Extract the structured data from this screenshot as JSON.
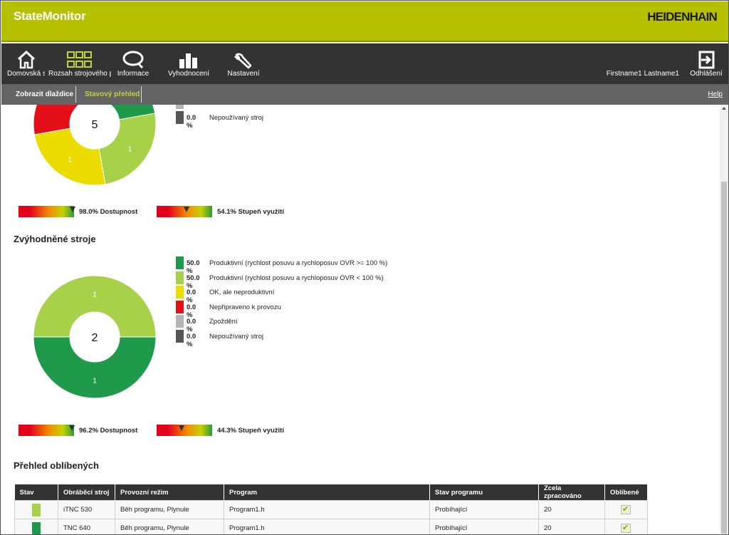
{
  "header": {
    "app_title": "StateMonitor",
    "brand": "HEIDENHAIN"
  },
  "nav": {
    "items": [
      {
        "label": "Domovská s",
        "icon": "home-icon"
      },
      {
        "label": "Rozsah strojového p",
        "icon": "grid-icon"
      },
      {
        "label": "Informace",
        "icon": "speech-bubble-icon"
      },
      {
        "label": "Vyhodnocení",
        "icon": "bar-chart-icon"
      },
      {
        "label": "Nastavení",
        "icon": "wrench-icon"
      }
    ],
    "user_name": "Firstname1 Lastname1",
    "logout_label": "Odhlášení"
  },
  "subnav": {
    "tiles": "Zobrazit dlaždice",
    "status": "Stavový přehled",
    "help": "Help"
  },
  "colors": {
    "productive_high": "#1f9a4a",
    "productive_low": "#a8d14a",
    "ok_unproductive": "#ecdc00",
    "not_ready": "#e3101a",
    "delay": "#b4b4b4",
    "unused": "#555555"
  },
  "top_group": {
    "total": "5",
    "segments": [
      {
        "key": "productive_high",
        "value": 1,
        "label": ""
      },
      {
        "key": "productive_low",
        "value": 1,
        "label": "1"
      },
      {
        "key": "ok_unproductive",
        "value": 1,
        "label": "1"
      },
      {
        "key": "not_ready",
        "value": 1,
        "label": "1"
      }
    ],
    "legend_visible": [
      {
        "key": "delay",
        "pct": "",
        "text": ""
      },
      {
        "key": "unused",
        "pct": "0.0 %",
        "text": "Nepoužívaný stroj"
      }
    ],
    "availability": {
      "pct": 0.98,
      "text": "98.0% Dostupnost"
    },
    "utilization": {
      "pct": 0.541,
      "text": "54.1% Stupeň využití"
    }
  },
  "fav_group": {
    "title": "Zvýhodněné stroje",
    "total": "2",
    "segments": [
      {
        "key": "productive_high",
        "value": 1,
        "label": "1"
      },
      {
        "key": "productive_low",
        "value": 1,
        "label": "1"
      }
    ],
    "legend": [
      {
        "key": "productive_high",
        "pct": "50.0 %",
        "text": "Produktivní (rychlost posuvu a rychloposuv OVR >= 100 %)"
      },
      {
        "key": "productive_low",
        "pct": "50.0 %",
        "text": "Produktivní (rychlost posuvu a rychloposuv OVR < 100 %)"
      },
      {
        "key": "ok_unproductive",
        "pct": "0.0 %",
        "text": "OK, ale neproduktivní"
      },
      {
        "key": "not_ready",
        "pct": "0.0 %",
        "text": "Nepřipraveno k provozu"
      },
      {
        "key": "delay",
        "pct": "0.0 %",
        "text": "Zpoždění"
      },
      {
        "key": "unused",
        "pct": "0.0 %",
        "text": "Nepoužívaný stroj"
      }
    ],
    "availability": {
      "pct": 0.962,
      "text": "96.2% Dostupnost"
    },
    "utilization": {
      "pct": 0.443,
      "text": "44.3% Stupeň využití"
    }
  },
  "favorites": {
    "title": "Přehled oblíbených",
    "columns": [
      "Stav",
      "Obráběcí stroj",
      "Provozní režim",
      "Program",
      "Stav programu",
      "Zcela zpracováno",
      "Oblíbené"
    ],
    "rows": [
      {
        "status_key": "productive_low",
        "machine": "iTNC 530",
        "mode": "Běh programu, Plynule",
        "program": "Program1.h",
        "program_state": "Probíhající",
        "completed": "20",
        "favorite": true
      },
      {
        "status_key": "productive_high",
        "machine": "TNC 640",
        "mode": "Běh programu, Plynule",
        "program": "Program1.h",
        "program_state": "Probíhající",
        "completed": "20",
        "favorite": true
      }
    ]
  }
}
